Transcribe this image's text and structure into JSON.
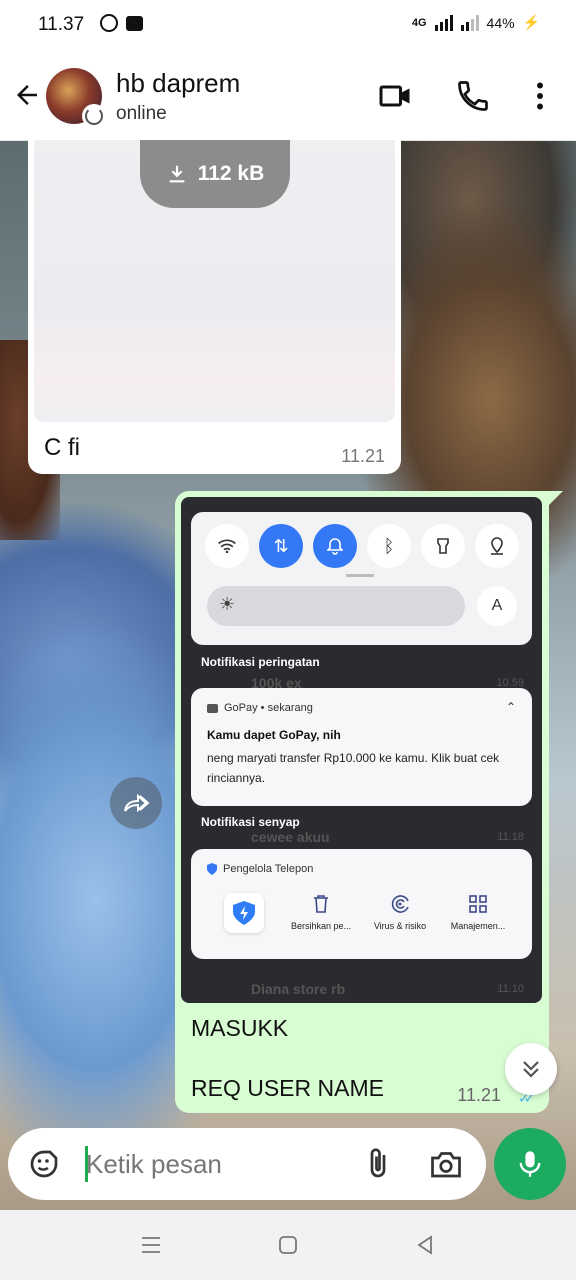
{
  "status_bar": {
    "time": "11.37",
    "network": "4G",
    "battery": "44%"
  },
  "header": {
    "contact_name": "hb daprem",
    "contact_status": "online"
  },
  "messages": {
    "incoming": {
      "download_size": "112 kB",
      "caption": "C fi",
      "time": "11.21"
    },
    "outgoing": {
      "screenshot": {
        "section_alert": "Notifikasi peringatan",
        "ghost_1": "100k ex",
        "ghost_1_time": "10.59",
        "gopay_app": "GoPay • sekarang",
        "gopay_title": "Kamu dapet GoPay, nih",
        "gopay_body": "neng maryati transfer Rp10.000 ke kamu. Klik buat cek rinciannya.",
        "section_silent": "Notifikasi senyap",
        "ghost_2": "cewee akuu",
        "ghost_2_time": "11.18",
        "phone_manager_app": "Pengelola Telepon",
        "tools": [
          "Bersihkan pe...",
          "Virus & risiko",
          "Manajemen..."
        ],
        "ghost_3": "Diana store rb",
        "ghost_3_time": "11.10",
        "auto_brightness": "A"
      },
      "line_1": "MASUKK",
      "line_2": "REQ USER NAME",
      "time": "11.21"
    }
  },
  "composer": {
    "placeholder": "Ketik pesan"
  },
  "colors": {
    "accent": "#1daa61",
    "outgoing_bubble": "#d9fdd3",
    "read_ticks": "#53bdeb",
    "qs_active": "#3478f6"
  }
}
